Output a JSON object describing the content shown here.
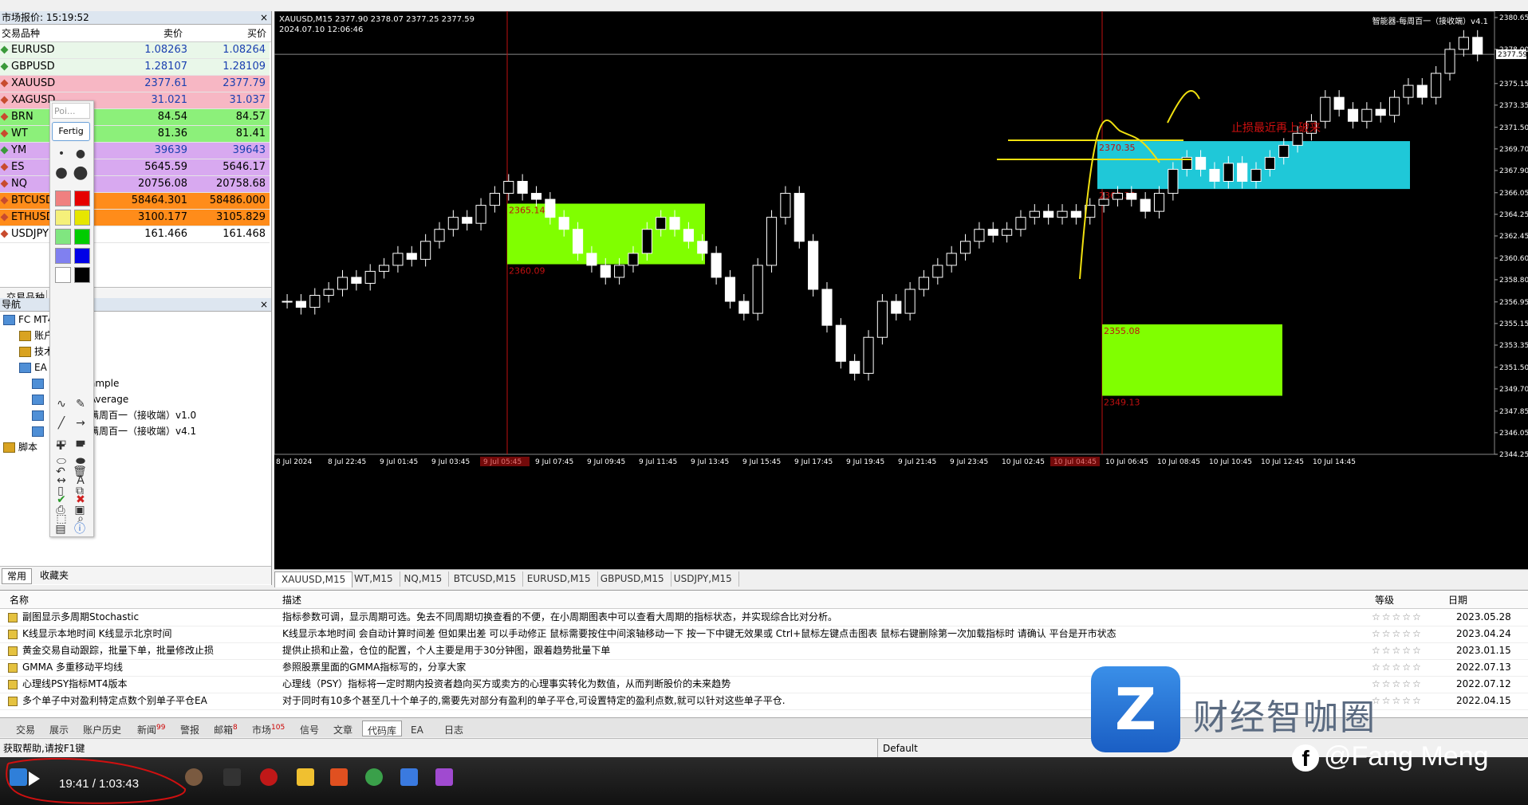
{
  "market_watch": {
    "title": "市场报价: 15:19:52",
    "close": "×",
    "col_symbol": "交易品种",
    "col_bid": "卖价",
    "col_ask": "买价",
    "rows": [
      {
        "sym": "EURUSD",
        "bid": "1.08263",
        "ask": "1.08264",
        "bg": "#e9f7e9",
        "fg": "#1a3fb0",
        "dir": "up"
      },
      {
        "sym": "GBPUSD",
        "bid": "1.28107",
        "ask": "1.28109",
        "bg": "#e9f7e9",
        "fg": "#1a3fb0",
        "dir": "up"
      },
      {
        "sym": "XAUUSD",
        "bid": "2377.61",
        "ask": "2377.79",
        "bg": "#f7b7c4",
        "fg": "#1a3fb0",
        "dir": "down"
      },
      {
        "sym": "XAGUSD",
        "bid": "31.021",
        "ask": "31.037",
        "bg": "#f7b7c4",
        "fg": "#1a3fb0",
        "dir": "down"
      },
      {
        "sym": "BRN",
        "bid": "84.54",
        "ask": "84.57",
        "bg": "#8cf07a",
        "fg": "#000",
        "dir": "down"
      },
      {
        "sym": "WT",
        "bid": "81.36",
        "ask": "81.41",
        "bg": "#8cf07a",
        "fg": "#000",
        "dir": "down"
      },
      {
        "sym": "YM",
        "bid": "39639",
        "ask": "39643",
        "bg": "#d8a9f0",
        "fg": "#1a3fb0",
        "dir": "up"
      },
      {
        "sym": "ES",
        "bid": "5645.59",
        "ask": "5646.17",
        "bg": "#d8a9f0",
        "fg": "#000",
        "dir": "down"
      },
      {
        "sym": "NQ",
        "bid": "20756.08",
        "ask": "20758.68",
        "bg": "#d8a9f0",
        "fg": "#000",
        "dir": "down"
      },
      {
        "sym": "BTCUSD",
        "bid": "58464.301",
        "ask": "58486.000",
        "bg": "#ff8c1a",
        "fg": "#000",
        "dir": "down"
      },
      {
        "sym": "ETHUSD",
        "bid": "3100.177",
        "ask": "3105.829",
        "bg": "#ff8c1a",
        "fg": "#000",
        "dir": "down"
      },
      {
        "sym": "USDJPY",
        "bid": "161.466",
        "ask": "161.468",
        "bg": "#ffffff",
        "fg": "#000",
        "dir": "down"
      }
    ],
    "tab": "交易品种"
  },
  "navigator": {
    "title": "导航",
    "close": "×",
    "items": [
      "FC MT4",
      "账户",
      "技术",
      "EA",
      "ample",
      "Average",
      "满周百一（接收端）v1.0",
      "满周百一（接收端）v4.1",
      "脚本"
    ],
    "tabs": [
      "常用",
      "收藏夹"
    ]
  },
  "palette": {
    "input_placeholder": "Poi...",
    "button": "Fertig",
    "colors": [
      "#f08080",
      "#e60000",
      "#f5f07a",
      "#e6e600",
      "#80e680",
      "#00cc00",
      "#8080f0",
      "#0000e6",
      "#ffffff",
      "#000000"
    ]
  },
  "chart": {
    "symbol_line": "XAUUSD,M15  2377.90 2378.07 2377.25 2377.59",
    "date_line": "2024.07.10 12:06:46",
    "ea_label": "智能器-每周百一（接收端）v4.1",
    "annotation_text": "止损最近再上破来",
    "price_labels": [
      "2380.65",
      "2378.00",
      "2375.15",
      "2373.35",
      "2371.50",
      "2369.70",
      "2367.90",
      "2366.05",
      "2364.25",
      "2362.45",
      "2360.60",
      "2358.80",
      "2356.95",
      "2355.15",
      "2353.35",
      "2351.50",
      "2349.70",
      "2347.85",
      "2346.05",
      "2344.25"
    ],
    "current_price": "2377.59",
    "time_labels": [
      "8 Jul 2024",
      "8 Jul 22:45",
      "9 Jul 01:45",
      "9 Jul 03:45",
      "9 Jul 05:45",
      "9 Jul 07:45",
      "9 Jul 09:45",
      "9 Jul 11:45",
      "9 Jul 13:45",
      "9 Jul 15:45",
      "9 Jul 17:45",
      "9 Jul 19:45",
      "9 Jul 21:45",
      "9 Jul 23:45",
      "10 Jul 02:45",
      "10 Jul 04:45",
      "10 Jul 06:45",
      "10 Jul 08:45",
      "10 Jul 10:45",
      "10 Jul 12:45",
      "10 Jul 14:45"
    ],
    "zones": [
      {
        "top": "2365.14",
        "bottom": "2360.09",
        "color": "#80ff00"
      },
      {
        "top": "2370.35",
        "bottom": "2366.36",
        "color": "#1fc8d8"
      },
      {
        "top": "2355.08",
        "bottom": "2349.13",
        "color": "#80ff00"
      }
    ],
    "tabs": [
      "XAUUSD,M15",
      "WT,M15",
      "NQ,M15",
      "BTCUSD,M15",
      "EURUSD,M15",
      "GBPUSD,M15",
      "USDJPY,M15"
    ]
  },
  "terminal": {
    "col_name": "名称",
    "col_desc": "描述",
    "col_rating": "等级",
    "col_date": "日期",
    "rating_stars": "☆☆☆☆☆",
    "rows": [
      {
        "name": "副图显示多周期Stochastic",
        "desc": "指标参数可调，显示周期可选。免去不同周期切换查看的不便，在小周期图表中可以查看大周期的指标状态，并实现综合比对分析。",
        "date": "2023.05.28"
      },
      {
        "name": "K线显示本地时间 K线显示北京时间",
        "desc": "K线显示本地时间 会自动计算时间差 但如果出差 可以手动修正 鼠标需要按住中间滚轴移动一下  按一下中键无效果或 Ctrl+鼠标左键点击图表 鼠标右键删除第一次加载指标时 请确认 平台是开市状态",
        "date": "2023.04.24"
      },
      {
        "name": "黄金交易自动跟踪，批量下单，批量修改止损",
        "desc": "提供止损和止盈，仓位的配置，个人主要是用于30分钟图，跟着趋势批量下单",
        "date": "2023.01.15"
      },
      {
        "name": "GMMA 多重移动平均线",
        "desc": "参照股票里面的GMMA指标写的，分享大家",
        "date": "2022.07.13"
      },
      {
        "name": "心理线PSY指标MT4版本",
        "desc": "心理线（PSY）指标将一定时期内投资者趋向买方或卖方的心理事实转化为数值，从而判断股价的未来趋势",
        "date": "2022.07.12"
      },
      {
        "name": "多个单子中对盈利特定点数个别单子平仓EA",
        "desc": "对于同时有10多个甚至几十个单子的,需要先对部分有盈利的单子平仓,可设置特定的盈利点数,就可以针对这些单子平仓.",
        "date": "2022.04.15"
      }
    ],
    "tabs": [
      {
        "label": "交易",
        "badge": ""
      },
      {
        "label": "展示",
        "badge": ""
      },
      {
        "label": "账户历史",
        "badge": ""
      },
      {
        "label": "新闻",
        "badge": "99"
      },
      {
        "label": "警报",
        "badge": ""
      },
      {
        "label": "邮箱",
        "badge": "8"
      },
      {
        "label": "市场",
        "badge": "105"
      },
      {
        "label": "信号",
        "badge": ""
      },
      {
        "label": "文章",
        "badge": ""
      },
      {
        "label": "代码库",
        "badge": ""
      },
      {
        "label": "EA",
        "badge": ""
      },
      {
        "label": "日志",
        "badge": ""
      }
    ]
  },
  "status_bar": {
    "help": "获取帮助,请按F1键",
    "profile": "Default"
  },
  "overlay": {
    "video_time": "19:41 / 1:03:43",
    "watermark_text": "财经智咖圈",
    "social": "@Fang Meng"
  }
}
